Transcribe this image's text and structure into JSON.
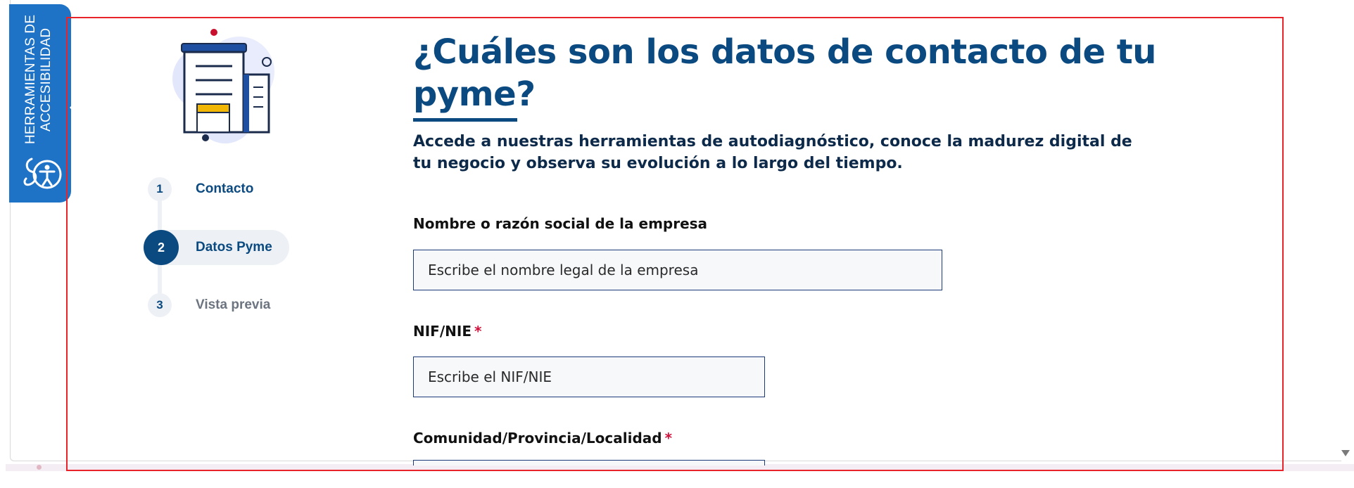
{
  "accessibility_tab": {
    "label_line1": "HERRAMIENTAS DE",
    "label_line2": "ACCESIBILIDAD",
    "icon": "accessibility-person-icon",
    "color": "#1f73c7"
  },
  "stepper": {
    "steps": [
      {
        "number": "1",
        "label": "Contacto",
        "state": "completed"
      },
      {
        "number": "2",
        "label": "Datos Pyme",
        "state": "active"
      },
      {
        "number": "3",
        "label": "Vista previa",
        "state": "pending"
      }
    ]
  },
  "main": {
    "title": "¿Cuáles son los datos de contacto de tu pyme?",
    "subtitle": "Accede a nuestras herramientas de autodiagnóstico, conoce la madurez digital de tu negocio y observa su evolución a lo largo del tiempo.",
    "fields": [
      {
        "label": "Nombre o razón social de la empresa",
        "required": false,
        "placeholder": "Escribe el nombre legal de la empresa",
        "value": ""
      },
      {
        "label": "NIF/NIE",
        "required": true,
        "placeholder": "Escribe el NIF/NIE",
        "value": ""
      },
      {
        "label": "Comunidad/Provincia/Localidad",
        "required": true
      }
    ],
    "required_marker": "*"
  },
  "colors": {
    "primary": "#0b4a80",
    "required": "#d0103a",
    "highlight_outline": "#e8232a"
  }
}
